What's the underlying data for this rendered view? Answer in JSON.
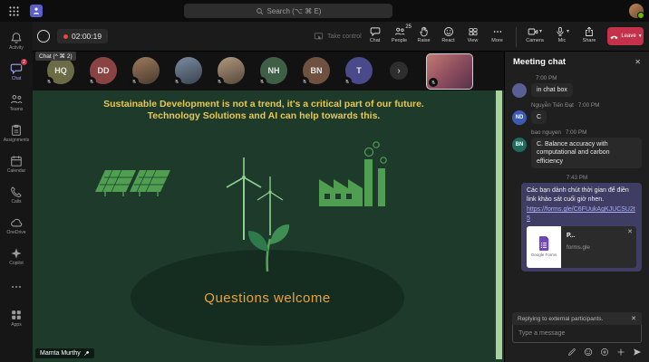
{
  "titlebar": {
    "search_placeholder": "Search (⌥ ⌘ E)"
  },
  "left_rail": {
    "items": [
      {
        "label": "Activity",
        "badge": ""
      },
      {
        "label": "Chat",
        "badge": "2"
      },
      {
        "label": "Teams",
        "badge": ""
      },
      {
        "label": "Assignments",
        "badge": ""
      },
      {
        "label": "Calendar",
        "badge": ""
      },
      {
        "label": "Calls",
        "badge": ""
      },
      {
        "label": "OneDrive",
        "badge": ""
      },
      {
        "label": "Copilot",
        "badge": ""
      },
      {
        "label": "",
        "badge": ""
      },
      {
        "label": "Apps",
        "badge": ""
      }
    ]
  },
  "toolbar": {
    "timer": "02:00:19",
    "take_control_label": "Take control",
    "buttons": [
      {
        "label": "Chat"
      },
      {
        "label": "People",
        "count": "25"
      },
      {
        "label": "Raise"
      },
      {
        "label": "React"
      },
      {
        "label": "View"
      },
      {
        "label": "More"
      }
    ],
    "camera_label": "Camera",
    "mic_label": "Mic",
    "share_label": "Share",
    "leave_label": "Leave"
  },
  "filmstrip": {
    "tooltip": "Chat (^ ⌘ 2)",
    "participants": [
      {
        "initials": "HQ"
      },
      {
        "initials": "DD"
      },
      {
        "initials": ""
      },
      {
        "initials": ""
      },
      {
        "initials": ""
      },
      {
        "initials": "NH"
      },
      {
        "initials": "BN"
      },
      {
        "initials": "T"
      }
    ]
  },
  "slide": {
    "heading_line1": "Sustainable Development is not a trend, it's a critical part of our future.",
    "heading_line2": "Technology Solutions and AI can help towards this.",
    "ellipse_text": "Questions welcome",
    "presenter_name": "Mamta Murthy"
  },
  "chat": {
    "title": "Meeting chat",
    "messages": [
      {
        "name": "",
        "time": "7:00 PM",
        "text": "in chat box",
        "initials": ""
      },
      {
        "name": "Nguyễn Tiến Đạt",
        "time": "7:00 PM",
        "text": "C",
        "initials": "ND"
      },
      {
        "name": "bao nguyen",
        "time": "7:00 PM",
        "text": "C. Balance accuracy with computational and carbon efficiency",
        "initials": "BN"
      },
      {
        "divider": "7:43 PM"
      },
      {
        "outgoing_text": "Các bạn dành chút thời gian để điền link khảo sát cuối giờ nhen.",
        "link": "https://forms.gle/C6FUukAgKJUCSU2t5",
        "preview": {
          "title": "P...",
          "provider": "Google Forms",
          "domain": "forms.gle"
        }
      }
    ],
    "reply_banner": "Replying to external participants.",
    "input_placeholder": "Type a message"
  },
  "colors": {
    "accent": "#5b5fc7",
    "leave_red": "#c4314b",
    "presence_green": "#6bb700",
    "badge_red": "#c4314b",
    "link": "#aab0f5",
    "slide_bg": "#1d3a2a",
    "slide_heading": "#e9c850",
    "slide_graphic": "#58a35a",
    "slide_accent_strip": "#a7d39a",
    "ellipse_bg": "#152d20",
    "ellipse_text": "#e8a23f"
  }
}
